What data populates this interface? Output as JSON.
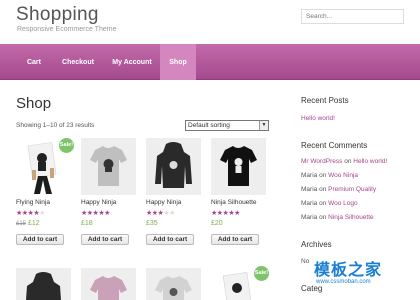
{
  "header": {
    "site_title": "Shopping",
    "tagline": "Responsive Ecommerce Theme",
    "search_placeholder": "Search..."
  },
  "nav": {
    "items": [
      {
        "label": "Cart"
      },
      {
        "label": "Checkout"
      },
      {
        "label": "My Account"
      },
      {
        "label": "Shop",
        "active": true
      }
    ]
  },
  "main": {
    "title": "Shop",
    "result_count": "Showing 1–10 of 23 results",
    "sorting": "Default sorting",
    "sale_label": "Sale!",
    "add_to_cart": "Add to cart",
    "products": [
      {
        "name": "Flying Ninja",
        "rating": 4,
        "old_price": "£15",
        "price": "£12",
        "sale": true,
        "image": "poster"
      },
      {
        "name": "Happy Ninja",
        "rating": 5,
        "price": "£18",
        "sale": false,
        "image": "tshirt-grey"
      },
      {
        "name": "Happy Ninja",
        "rating": 3,
        "price": "£35",
        "sale": false,
        "image": "hoodie-black"
      },
      {
        "name": "Ninja Silhouette",
        "rating": 5,
        "price": "£20",
        "sale": false,
        "image": "tshirt-black"
      }
    ],
    "second_row": [
      {
        "image": "hoodie-black",
        "sale": false
      },
      {
        "image": "tshirt-pink",
        "sale": false
      },
      {
        "image": "tshirt-grey",
        "sale": false
      },
      {
        "image": "poster",
        "sale": true
      }
    ]
  },
  "sidebar": {
    "recent_posts_title": "Recent Posts",
    "recent_posts": [
      "Hello world!"
    ],
    "recent_comments_title": "Recent Comments",
    "recent_comments": [
      {
        "author": "Mr WordPress",
        "on": "on",
        "post": "Hello world!"
      },
      {
        "author": "Maria",
        "on": "on",
        "post": "Woo Ninja"
      },
      {
        "author": "Maria",
        "on": "on",
        "post": "Premium Quality"
      },
      {
        "author": "Maria",
        "on": "on",
        "post": "Woo Logo"
      },
      {
        "author": "Maria",
        "on": "on",
        "post": "Ninja Silhouette"
      }
    ],
    "archives_title": "Archives",
    "archives_first": "No",
    "categories_title": "Categ"
  },
  "watermark": {
    "main": "模板之家",
    "sub": "www.cssmoban.com"
  },
  "colors": {
    "nav": "#b25a9b",
    "accent": "#a6468b",
    "price": "#7fae52",
    "sale_badge": "#7fc36b"
  }
}
